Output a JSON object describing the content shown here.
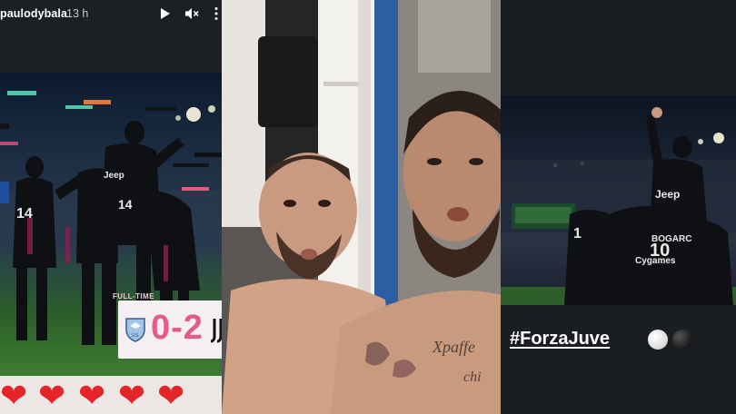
{
  "story_left": {
    "username": "paulodybala",
    "time": "13 h",
    "play_icon": "play-icon",
    "mute_icon": "mute-icon",
    "more_icon": "more-dots-icon",
    "scoreboard": {
      "label": "FULL-TIME",
      "score": "0-2",
      "home_logo": "lazio-crest",
      "away_logo": "juventus-logo"
    },
    "hearts": [
      "❤",
      "❤",
      "❤",
      "❤",
      "❤"
    ],
    "heart_color": "#e5242a"
  },
  "story_middle": {
    "photo": "locker-room-selfie"
  },
  "story_right": {
    "hashtag": "#ForzaJuve",
    "emoji": [
      "white-circle",
      "black-circle"
    ]
  }
}
